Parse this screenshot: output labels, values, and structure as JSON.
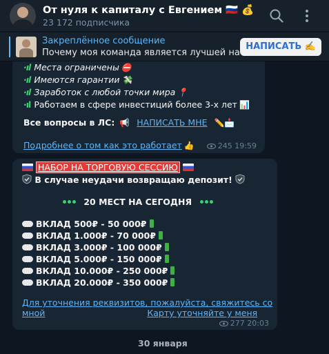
{
  "header": {
    "title": "От нуля к капиталу с Евгением 🇷🇺 💰",
    "subscribers": "23 172 подписчика"
  },
  "pinned": {
    "title": "Закреплённое сообщение",
    "text": "Почему моя команда является лучшей на р...",
    "button": "НАПИСАТЬ ✍️"
  },
  "message1": {
    "items": [
      "Места ограничены",
      "Имеются гарантии",
      "Заработок с любой точки мира",
      "Работаем в сфере инвестиций более 3-х лет"
    ],
    "questions_label": "Все вопросы в ЛС:",
    "write_link": "НАПИСАТЬ МНЕ",
    "more_link": "Подробнее о том как это работает",
    "views": "245",
    "time": "19:59"
  },
  "message2": {
    "header": "НАБОР НА ТОРГОВУЮ СЕССИЮ",
    "deposit_note": "В случае неудачи возвращаю депозит!",
    "seats": "20 МЕСТ НА СЕГОДНЯ",
    "deposits": [
      "ВКЛАД 500₽ - 50 000₽",
      "ВКЛАД 1.000₽ - 70 000₽",
      "ВКЛАД 3.000₽ - 100 000₽",
      "ВКЛАД 5.000₽ - 150 000₽",
      "ВКЛАД 10.000₽ - 250 000₽",
      "ВКЛАД 20.000₽ - 350 000₽"
    ],
    "footer_link_1": "Для уточнения реквизитов, пожалуйста, свяжитесь со",
    "footer_link_2a": "мной",
    "footer_link_2b": "Карту уточняйте у меня",
    "views": "277",
    "time": "20:03"
  },
  "date_separator": "30 января",
  "colors": {
    "background": "#0e1621",
    "bubble": "#182533",
    "link": "#5eb5f7",
    "header": "#17212b"
  }
}
